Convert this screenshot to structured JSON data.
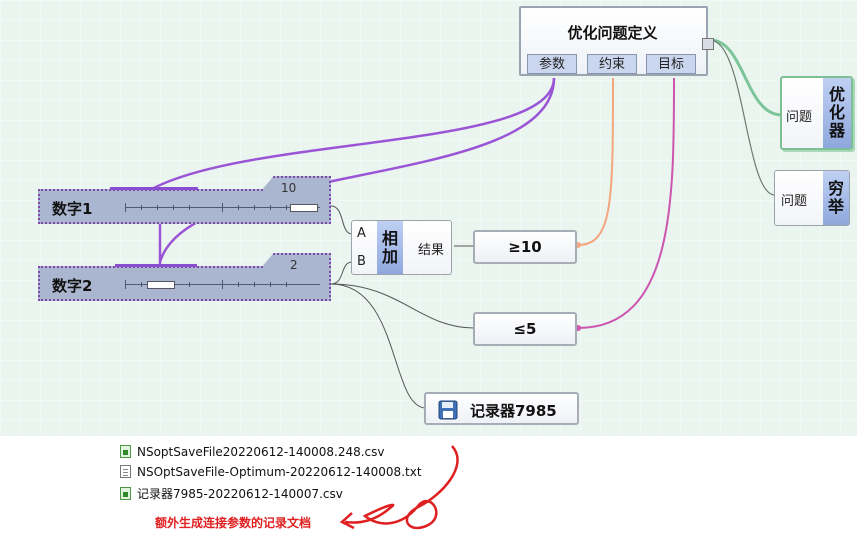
{
  "opt_def": {
    "title": "优化问题定义",
    "ports": [
      "参数",
      "约束",
      "目标"
    ]
  },
  "optimizer": {
    "input": "问题",
    "label": "优化器"
  },
  "exhaustive": {
    "input": "问题",
    "label": "穷举"
  },
  "slider1": {
    "name": "数字1",
    "value": "10"
  },
  "slider2": {
    "name": "数字2",
    "value": "2"
  },
  "add": {
    "input_a": "A",
    "input_b": "B",
    "label": "相加",
    "output": "结果"
  },
  "constraint_ge": "≥10",
  "constraint_le": "≤5",
  "recorder": {
    "label": "记录器7985"
  },
  "files": [
    {
      "name": "NSoptSaveFile20220612-140008.248.csv",
      "type": "csv"
    },
    {
      "name": "NSOptSaveFile-Optimum-20220612-140008.txt",
      "type": "txt"
    },
    {
      "name": "记录器7985-20220612-140007.csv",
      "type": "csv"
    }
  ],
  "annotation": "额外生成连接参数的记录文档",
  "colors": {
    "param_wire": "#9a55d6",
    "constraint_wire": "#f4a67e",
    "objective_wire": "#cc55b0",
    "optimizer_wire": "#7cc59a",
    "annotation": "#e02020"
  }
}
